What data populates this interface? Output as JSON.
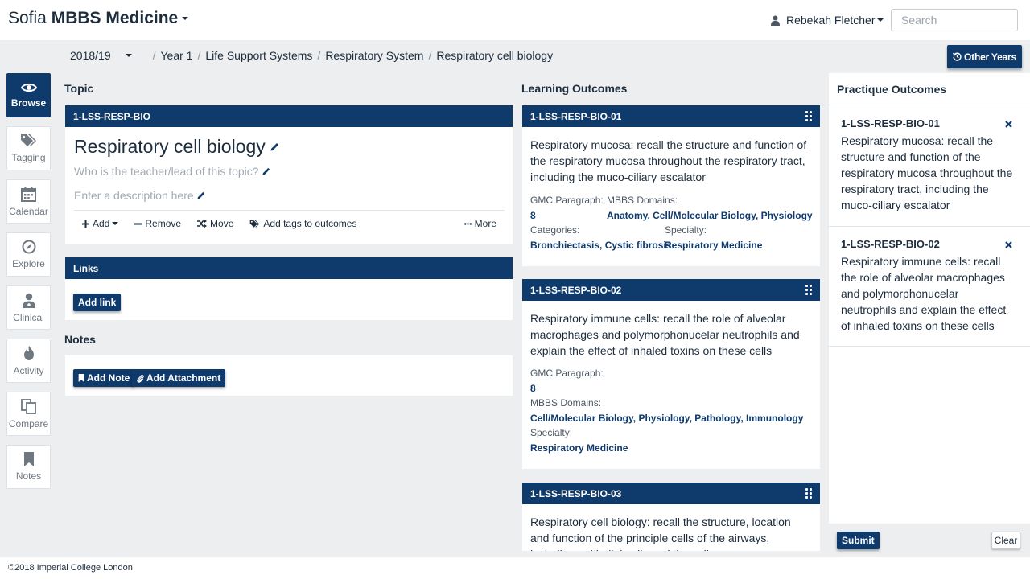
{
  "header": {
    "brand_prefix": "Sofia",
    "brand_name": "MBBS Medicine",
    "user_name": "Rebekah Fletcher",
    "search_placeholder": "Search"
  },
  "breadcrumb": {
    "year": "2018/19",
    "items": [
      "Year 1",
      "Life Support Systems",
      "Respiratory System",
      "Respiratory cell biology"
    ],
    "other_years_label": "Other Years"
  },
  "sidenav": [
    {
      "label": "Browse",
      "icon": "eye-icon",
      "active": true
    },
    {
      "label": "Tagging",
      "icon": "tags-icon"
    },
    {
      "label": "Calendar",
      "icon": "calendar-icon"
    },
    {
      "label": "Explore",
      "icon": "compass-icon"
    },
    {
      "label": "Clinical",
      "icon": "doctor-icon"
    },
    {
      "label": "Activity",
      "icon": "fire-icon"
    },
    {
      "label": "Compare",
      "icon": "copy-icon"
    },
    {
      "label": "Notes",
      "icon": "bookmark-icon"
    }
  ],
  "topic": {
    "section_title": "Topic",
    "code": "1-LSS-RESP-BIO",
    "title": "Respiratory cell biology",
    "lead_placeholder": "Who is the teacher/lead of this topic?",
    "description_placeholder": "Enter a description here",
    "tools": {
      "add": "Add",
      "remove": "Remove",
      "move": "Move",
      "tag": "Add tags to outcomes",
      "more": "More"
    }
  },
  "links": {
    "title": "Links",
    "add_link_label": "Add link"
  },
  "notes": {
    "section_title": "Notes",
    "add_note_label": "Add Note",
    "add_attachment_label": "Add Attachment"
  },
  "learning_outcomes": {
    "section_title": "Learning Outcomes",
    "labels": {
      "gmc": "GMC Paragraph:",
      "domains": "MBBS Domains:",
      "categories": "Categories:",
      "specialty": "Specialty:"
    },
    "items": [
      {
        "code": "1-LSS-RESP-BIO-01",
        "text": "Respiratory mucosa: recall the structure and function of the respiratory mucosa throughout the respiratory tract, including the muco-ciliary escalator",
        "gmc": "8",
        "domains": "Anatomy, Cell/Molecular Biology, Physiology",
        "categories": "Bronchiectasis, Cystic fibrosis",
        "specialty": "Respiratory Medicine"
      },
      {
        "code": "1-LSS-RESP-BIO-02",
        "text": "Respiratory immune cells: recall the role of alveolar macrophages and polymorphonucelar neutrophils and explain the effect of inhaled toxins on these cells",
        "gmc": "8",
        "domains": "Cell/Molecular Biology, Physiology, Pathology, Immunology",
        "specialty": "Respiratory Medicine"
      },
      {
        "code": "1-LSS-RESP-BIO-03",
        "text": "Respiratory cell biology: recall the structure, location and function of the principle cells of the airways, including epithelial cells and the cells"
      }
    ]
  },
  "practique": {
    "title": "Practique Outcomes",
    "items": [
      {
        "code": "1-LSS-RESP-BIO-01",
        "text": "Respiratory mucosa: recall the structure and function of the respiratory mucosa throughout the respiratory tract, including the muco-ciliary escalator"
      },
      {
        "code": "1-LSS-RESP-BIO-02",
        "text": "Respiratory immune cells: recall the role of alveolar macrophages and polymorphonucelar neutrophils and explain the effect of inhaled toxins on these cells"
      }
    ],
    "submit_label": "Submit",
    "clear_label": "Clear"
  },
  "footer": {
    "text": "©2018 Imperial College London"
  },
  "colors": {
    "primary": "#0f3a6c",
    "background": "#eceeef"
  }
}
